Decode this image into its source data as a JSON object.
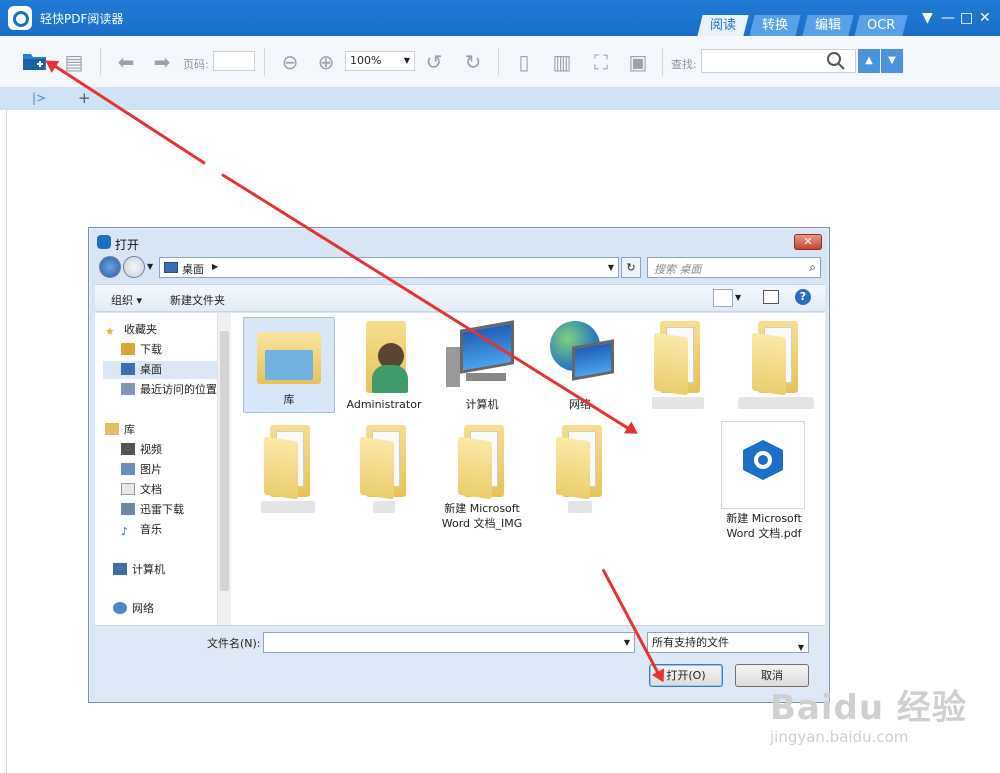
{
  "app": {
    "title": "轻快PDF阅读器",
    "tabs": [
      "阅读",
      "转换",
      "编辑",
      "OCR"
    ],
    "window_controls": [
      "▼",
      "—",
      "□",
      "✕"
    ]
  },
  "toolbar": {
    "page_label": "页码:",
    "page_value": "",
    "zoom_value": "100%",
    "search_label": "查找:",
    "search_value": ""
  },
  "doc_tabs": {
    "sidebar_toggle": "|>",
    "new_tab": "+"
  },
  "dialog": {
    "title": "打开",
    "close": "✕",
    "address_path": "桌面",
    "search_placeholder": "搜索 桌面",
    "organize_label": "组织 ▾",
    "new_folder_label": "新建文件夹",
    "nav": {
      "favorites": "收藏夹",
      "downloads": "下载",
      "desktop": "桌面",
      "recent": "最近访问的位置",
      "libraries": "库",
      "videos": "视频",
      "pictures": "图片",
      "documents": "文档",
      "xunlei": "迅雷下载",
      "music": "音乐",
      "computer": "计算机",
      "network": "网络"
    },
    "files": [
      {
        "label": "库"
      },
      {
        "label": "Administrator"
      },
      {
        "label": "计算机"
      },
      {
        "label": "网络"
      },
      {
        "label": ""
      },
      {
        "label": ""
      },
      {
        "label": ""
      },
      {
        "label": ""
      },
      {
        "label": "新建 Microsoft Word 文档_IMG"
      },
      {
        "label": ""
      },
      {
        "label": "新建 Microsoft Word 文档.pdf"
      }
    ],
    "filename_label": "文件名(N):",
    "filename_value": "",
    "filetype_value": "所有支持的文件",
    "open_button": "打开(O)",
    "cancel_button": "取消"
  },
  "watermark": {
    "brand": "Baidu 经验",
    "url": "jingyan.baidu.com"
  },
  "colors": {
    "titlebar": "#1a6fc8",
    "arrow": "#e53232",
    "pdf_icon": "#1a6fc8"
  }
}
